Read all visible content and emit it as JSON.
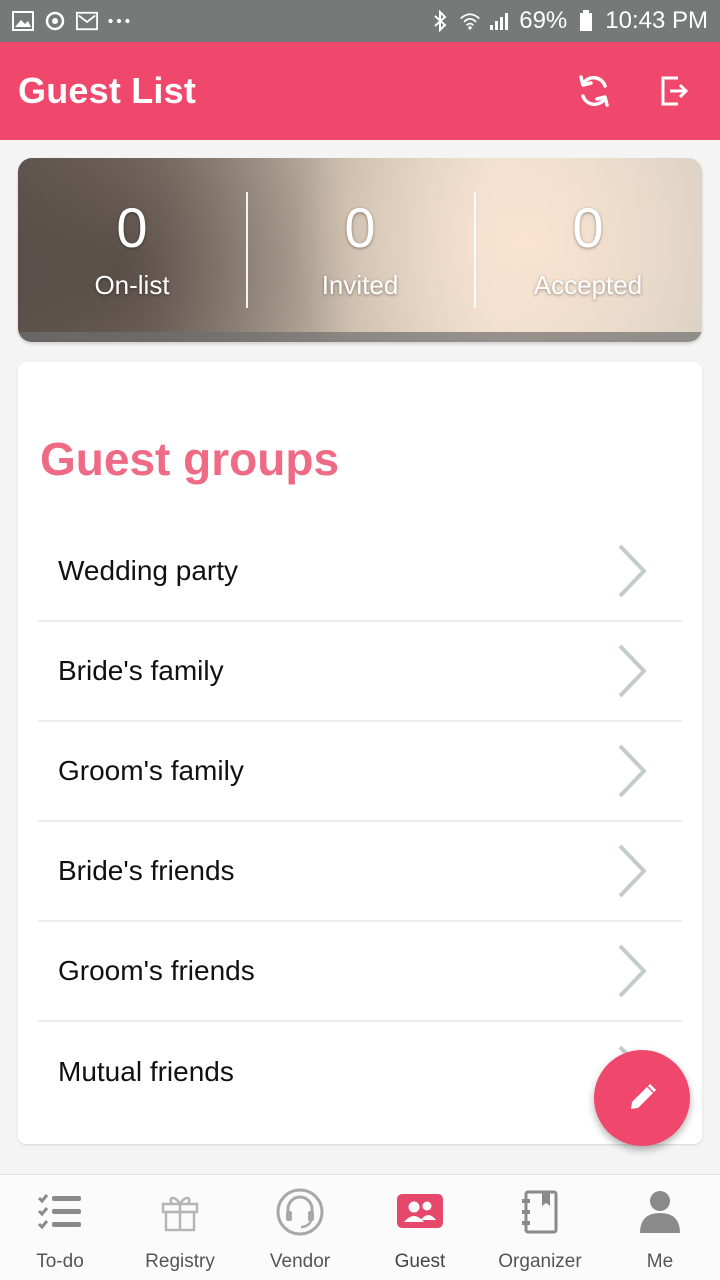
{
  "status_bar": {
    "battery": "69%",
    "time": "10:43 PM",
    "icons": [
      "image-icon",
      "sync-icon",
      "mail-icon",
      "more-icon",
      "bluetooth-icon",
      "wifi-icon",
      "signal-icon",
      "battery-icon"
    ]
  },
  "header": {
    "title": "Guest List",
    "actions": [
      "refresh-icon",
      "export-icon"
    ]
  },
  "stats": [
    {
      "value": "0",
      "label": "On-list"
    },
    {
      "value": "0",
      "label": "Invited"
    },
    {
      "value": "0",
      "label": "Accepted"
    }
  ],
  "groups": {
    "title": "Guest groups",
    "items": [
      {
        "label": "Wedding party"
      },
      {
        "label": "Bride's family"
      },
      {
        "label": "Groom's family"
      },
      {
        "label": "Bride's friends"
      },
      {
        "label": "Groom's friends"
      },
      {
        "label": "Mutual friends"
      }
    ]
  },
  "fab": {
    "icon": "edit-icon"
  },
  "bottom_nav": {
    "active": "Guest",
    "items": [
      {
        "label": "To-do",
        "icon": "checklist-icon"
      },
      {
        "label": "Registry",
        "icon": "gift-icon"
      },
      {
        "label": "Vendor",
        "icon": "headset-icon"
      },
      {
        "label": "Guest",
        "icon": "guests-icon"
      },
      {
        "label": "Organizer",
        "icon": "notebook-icon"
      },
      {
        "label": "Me",
        "icon": "person-icon"
      }
    ]
  },
  "colors": {
    "primary": "#f0486c",
    "title_pink": "#ee6a85",
    "statusbar": "#777878"
  }
}
